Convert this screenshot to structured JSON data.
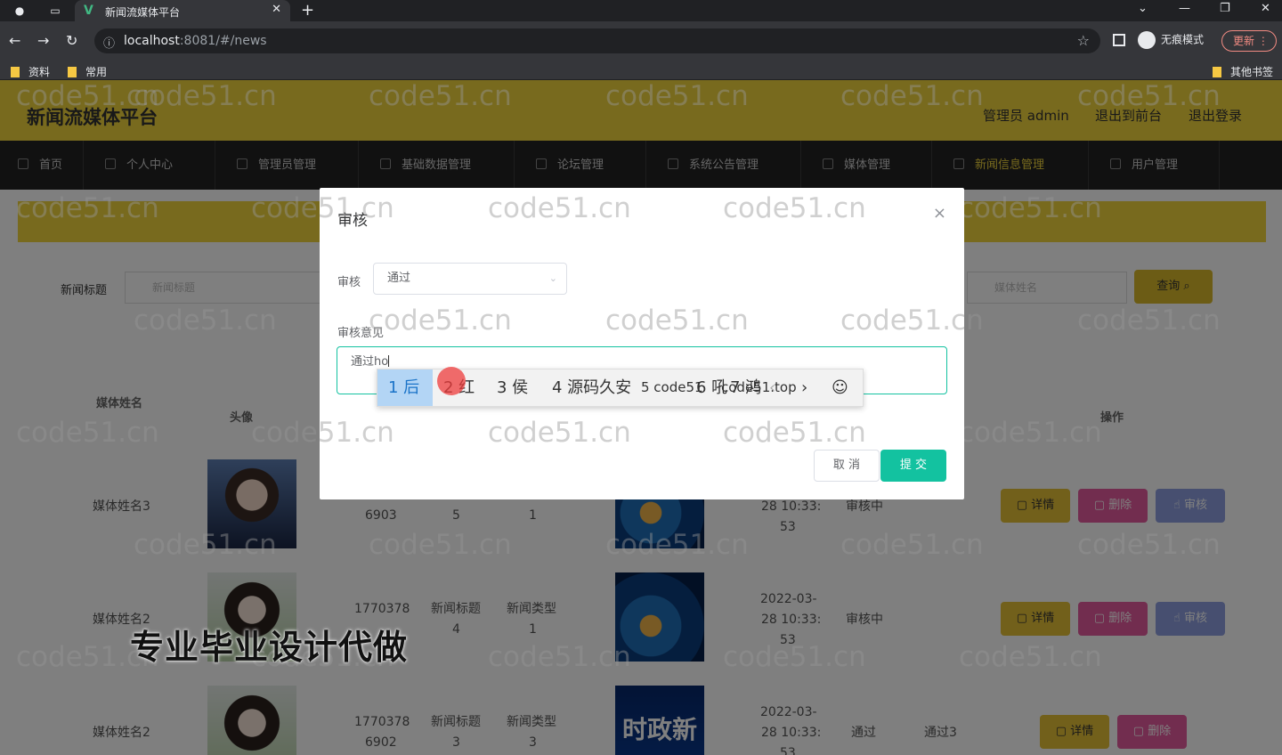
{
  "browser": {
    "tab_title": "新闻流媒体平台",
    "url_host": "localhost",
    "url_rest": ":8081/#/news",
    "incognito_label": "无痕模式",
    "update_label": "更新",
    "bookmarks": [
      "资料",
      "常用"
    ],
    "other_bookmarks": "其他书签"
  },
  "site": {
    "brand": "新闻流媒体平台",
    "header_links": [
      "管理员 admin",
      "退出到前台",
      "退出登录"
    ],
    "menu": [
      "首页",
      "个人中心",
      "管理员管理",
      "基础数据管理",
      "论坛管理",
      "系统公告管理",
      "媒体管理",
      "新闻信息管理",
      "用户管理"
    ]
  },
  "search": {
    "title_label": "新闻标题",
    "title_placeholder": "新闻标题",
    "media_placeholder": "媒体姓名",
    "query_label": "查询"
  },
  "table": {
    "headers": {
      "media_name": "媒体姓名",
      "avatar": "头像",
      "actions": "操作"
    },
    "rows": [
      {
        "media_name": "媒体姓名3",
        "code_a": "",
        "code_b": "6903",
        "title_a": "",
        "title_b": "5",
        "type_a": "",
        "type_b": "1",
        "time_a": "",
        "time_b": "28 10:33:",
        "time_c": "53",
        "status": "审核中",
        "opinion": ""
      },
      {
        "media_name": "媒体姓名2",
        "code_a": "1770378",
        "code_b": "",
        "title_a": "新闻标题",
        "title_b": "4",
        "type_a": "新闻类型",
        "type_b": "1",
        "time_a": "2022-03-",
        "time_b": "28 10:33:",
        "time_c": "53",
        "status": "审核中",
        "opinion": ""
      },
      {
        "media_name": "媒体姓名2",
        "code_a": "1770378",
        "code_b": "6902",
        "title_a": "新闻标题",
        "title_b": "3",
        "type_a": "新闻类型",
        "type_b": "3",
        "time_a": "2022-03-",
        "time_b": "28 10:33:",
        "time_c": "53",
        "status": "通过",
        "opinion": "通过3"
      }
    ],
    "actions": {
      "detail": "详情",
      "delete": "删除",
      "audit": "审核"
    },
    "news_image_text": "时政新闻"
  },
  "dialog": {
    "title": "审核",
    "audit_label": "审核",
    "audit_value": "通过",
    "opinion_label": "审核意见",
    "opinion_value": "通过ho",
    "cancel_label": "取 消",
    "submit_label": "提 交"
  },
  "ime": {
    "candidates": [
      "1 后",
      "2 红",
      "3 侯",
      "4 源码久安",
      "5 code51",
      "6 吼",
      "7 鸿"
    ],
    "overlay_text": "code51.top"
  },
  "overlay_ad": "专业毕业设计代做",
  "watermark_text": "code51.cn"
}
